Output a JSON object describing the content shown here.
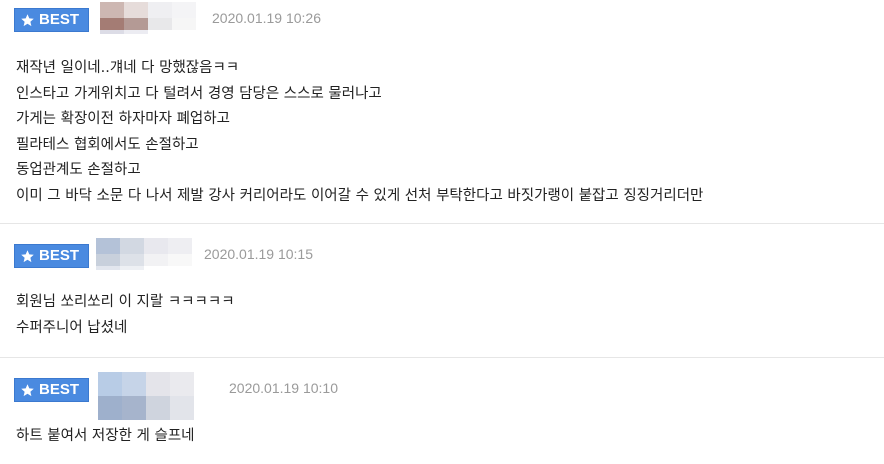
{
  "badge_label": "BEST",
  "comments": [
    {
      "timestamp": "2020.01.19 10:26",
      "lines": [
        "재작년 일이네..걔네 다 망했잖음ㅋㅋ",
        "인스타고 가게위치고 다 털려서 경영 담당은 스스로 물러나고",
        "가게는 확장이전 하자마자 폐업하고",
        "필라테스 협회에서도 손절하고",
        "동업관계도 손절하고",
        "이미 그 바닥 소문 다 나서 제발 강사 커리어라도 이어갈 수 있게 선처 부탁한다고 바짓가랭이 붙잡고 징징거리더만"
      ]
    },
    {
      "timestamp": "2020.01.19 10:15",
      "lines": [
        "회원님 쏘리쏘리 이 지랄 ㅋㅋㅋㅋㅋ",
        "수퍼주니어 납셨네"
      ]
    },
    {
      "timestamp": "2020.01.19 10:10",
      "lines": [
        "하트 붙여서 저장한 게 슬프네"
      ]
    }
  ],
  "icons": {
    "badge": "star-icon",
    "avatar": "blurred-avatar"
  },
  "colors": {
    "badge_bg": "#4a8ae0",
    "timestamp": "#9a9a9a",
    "text": "#222222",
    "divider": "#e6e6e6"
  }
}
